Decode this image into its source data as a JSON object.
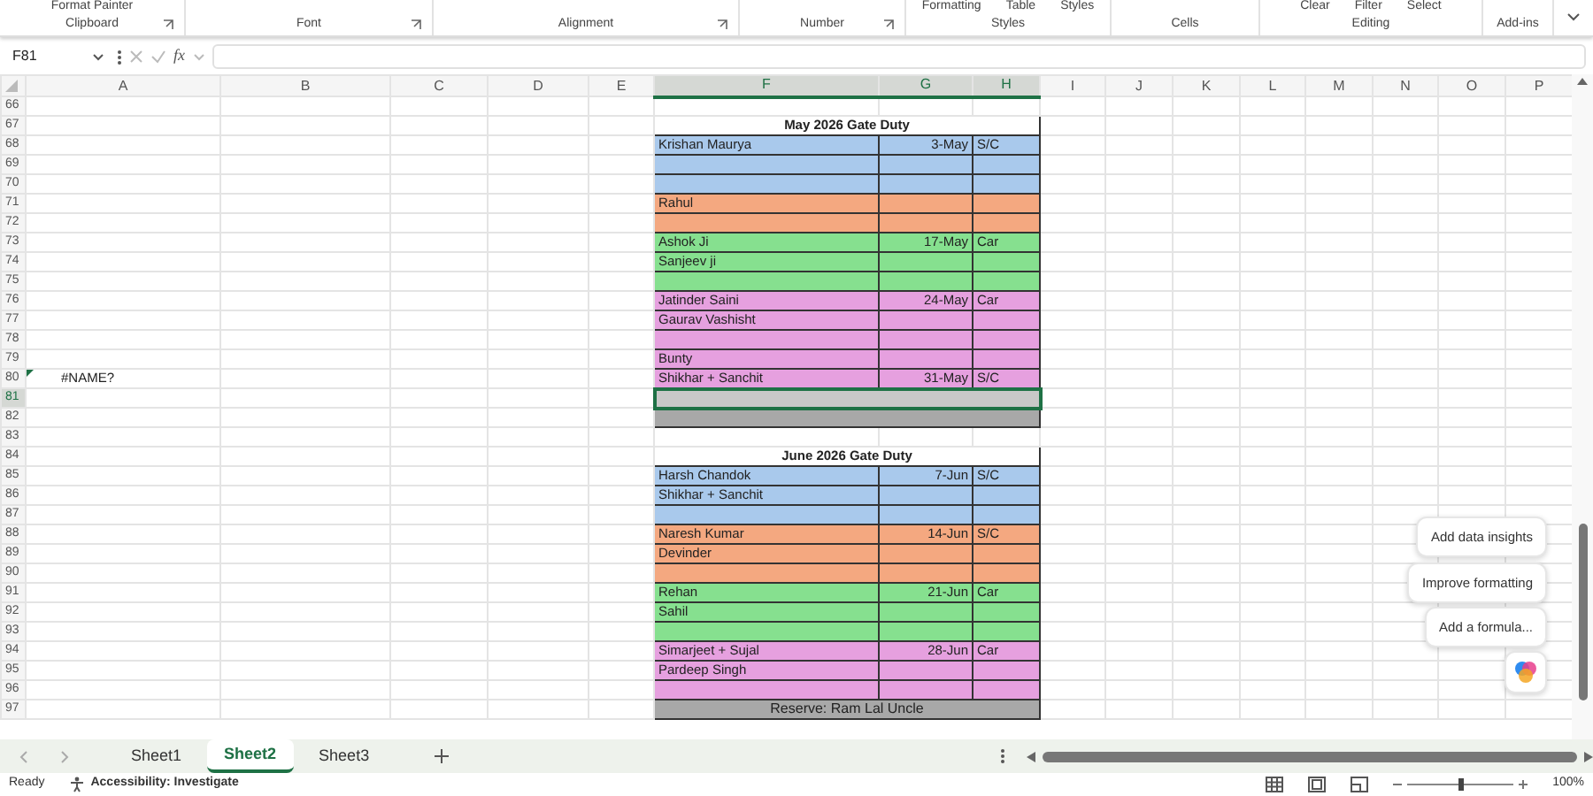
{
  "ribbon": {
    "groups": [
      {
        "label": "Clipboard",
        "items": [
          "Format Painter"
        ],
        "launcher": true
      },
      {
        "label": "Font",
        "launcher": true
      },
      {
        "label": "Alignment",
        "launcher": true
      },
      {
        "label": "Number",
        "launcher": true
      },
      {
        "label": "Styles",
        "items": [
          "Formatting",
          "Table",
          "Styles"
        ]
      },
      {
        "label": "Cells"
      },
      {
        "label": "Editing",
        "items": [
          "Clear",
          "Filter",
          "Select"
        ]
      },
      {
        "label": "Add-ins"
      }
    ]
  },
  "formula_bar": {
    "name_box": "F81",
    "function_button": "fx"
  },
  "sheet": {
    "columns": [
      {
        "label": "A",
        "selected": false
      },
      {
        "label": "B",
        "selected": false
      },
      {
        "label": "C",
        "selected": false
      },
      {
        "label": "D",
        "selected": false
      },
      {
        "label": "E",
        "selected": false
      },
      {
        "label": "F",
        "selected": true
      },
      {
        "label": "G",
        "selected": true
      },
      {
        "label": "H",
        "selected": true
      },
      {
        "label": "I",
        "selected": false
      },
      {
        "label": "J",
        "selected": false
      },
      {
        "label": "K",
        "selected": false
      },
      {
        "label": "L",
        "selected": false
      },
      {
        "label": "M",
        "selected": false
      },
      {
        "label": "N",
        "selected": false
      },
      {
        "label": "O",
        "selected": false
      },
      {
        "label": "P",
        "selected": false
      }
    ],
    "rows": [
      {
        "number": "66",
        "selected": false
      },
      {
        "number": "67",
        "selected": false,
        "duty": {
          "kind": "title",
          "text": "May 2026 Gate Duty"
        }
      },
      {
        "number": "68",
        "selected": false,
        "duty": {
          "kind": "entry",
          "color": "#a9c9ec",
          "name": "Krishan Maurya",
          "date": "3-May",
          "vehicle": "S/C"
        }
      },
      {
        "number": "69",
        "selected": false,
        "duty": {
          "kind": "entry",
          "color": "#a9c9ec"
        }
      },
      {
        "number": "70",
        "selected": false,
        "duty": {
          "kind": "entry",
          "color": "#a9c9ec"
        }
      },
      {
        "number": "71",
        "selected": false,
        "duty": {
          "kind": "entry",
          "color": "#f4a880",
          "name": "Rahul"
        }
      },
      {
        "number": "72",
        "selected": false,
        "duty": {
          "kind": "entry",
          "color": "#f4a880"
        }
      },
      {
        "number": "73",
        "selected": false,
        "duty": {
          "kind": "entry",
          "color": "#86e08f",
          "name": "Ashok Ji",
          "date": "17-May",
          "vehicle": "Car"
        }
      },
      {
        "number": "74",
        "selected": false,
        "duty": {
          "kind": "entry",
          "color": "#86e08f",
          "name": "Sanjeev ji"
        }
      },
      {
        "number": "75",
        "selected": false,
        "duty": {
          "kind": "entry",
          "color": "#86e08f"
        }
      },
      {
        "number": "76",
        "selected": false,
        "duty": {
          "kind": "entry",
          "color": "#e6a0df",
          "name": "Jatinder Saini",
          "date": "24-May",
          "vehicle": "Car"
        }
      },
      {
        "number": "77",
        "selected": false,
        "duty": {
          "kind": "entry",
          "color": "#e6a0df",
          "name": "Gaurav Vashisht"
        }
      },
      {
        "number": "78",
        "selected": false,
        "duty": {
          "kind": "entry",
          "color": "#e6a0df"
        }
      },
      {
        "number": "79",
        "selected": false,
        "duty": {
          "kind": "entry",
          "color": "#e6a0df",
          "name": "Bunty"
        }
      },
      {
        "number": "80",
        "selected": false,
        "a": "#NAME?",
        "duty": {
          "kind": "entry",
          "color": "#e6a0df",
          "name": "Shikhar + Sanchit",
          "date": "31-May",
          "vehicle": "S/C"
        }
      },
      {
        "number": "81",
        "selected": true,
        "duty": {
          "kind": "band",
          "selected": true
        }
      },
      {
        "number": "82",
        "selected": false,
        "duty": {
          "kind": "band",
          "selected": false
        }
      },
      {
        "number": "83",
        "selected": false
      },
      {
        "number": "84",
        "selected": false,
        "duty": {
          "kind": "title",
          "text": "June  2026 Gate Duty"
        }
      },
      {
        "number": "85",
        "selected": false,
        "duty": {
          "kind": "entry",
          "color": "#a9c9ec",
          "name": "Harsh Chandok",
          "date": "7-Jun",
          "vehicle": "S/C"
        }
      },
      {
        "number": "86",
        "selected": false,
        "duty": {
          "kind": "entry",
          "color": "#a9c9ec",
          "name": "Shikhar + Sanchit"
        }
      },
      {
        "number": "87",
        "selected": false,
        "duty": {
          "kind": "entry",
          "color": "#a9c9ec"
        }
      },
      {
        "number": "88",
        "selected": false,
        "duty": {
          "kind": "entry",
          "color": "#f4a880",
          "name": "Naresh Kumar",
          "date": "14-Jun",
          "vehicle": "S/C"
        }
      },
      {
        "number": "89",
        "selected": false,
        "duty": {
          "kind": "entry",
          "color": "#f4a880",
          "name": "Devinder"
        }
      },
      {
        "number": "90",
        "selected": false,
        "duty": {
          "kind": "entry",
          "color": "#f4a880"
        }
      },
      {
        "number": "91",
        "selected": false,
        "duty": {
          "kind": "entry",
          "color": "#86e08f",
          "name": "Rehan",
          "date": "21-Jun",
          "vehicle": "Car"
        }
      },
      {
        "number": "92",
        "selected": false,
        "duty": {
          "kind": "entry",
          "color": "#86e08f",
          "name": "Sahil"
        }
      },
      {
        "number": "93",
        "selected": false,
        "duty": {
          "kind": "entry",
          "color": "#86e08f"
        }
      },
      {
        "number": "94",
        "selected": false,
        "duty": {
          "kind": "entry",
          "color": "#e6a0df",
          "name": "Simarjeet + Sujal",
          "date": "28-Jun",
          "vehicle": "Car"
        }
      },
      {
        "number": "95",
        "selected": false,
        "duty": {
          "kind": "entry",
          "color": "#e6a0df",
          "name": "Pardeep Singh"
        }
      },
      {
        "number": "96",
        "selected": false,
        "duty": {
          "kind": "entry",
          "color": "#e6a0df"
        }
      },
      {
        "number": "97",
        "selected": false,
        "duty": {
          "kind": "reserve",
          "text": "Reserve: Ram Lal Uncle"
        }
      }
    ]
  },
  "suggestions": [
    "Add data insights",
    "Improve formatting",
    "Add a formula..."
  ],
  "sheet_tabs": [
    {
      "label": "Sheet1",
      "selected": false
    },
    {
      "label": "Sheet2",
      "selected": true
    },
    {
      "label": "Sheet3",
      "selected": false
    }
  ],
  "status_bar": {
    "status": "Ready",
    "accessibility": "Accessibility: Investigate",
    "zoom": "100%",
    "zoom_slider": {
      "level": 0.5
    }
  }
}
